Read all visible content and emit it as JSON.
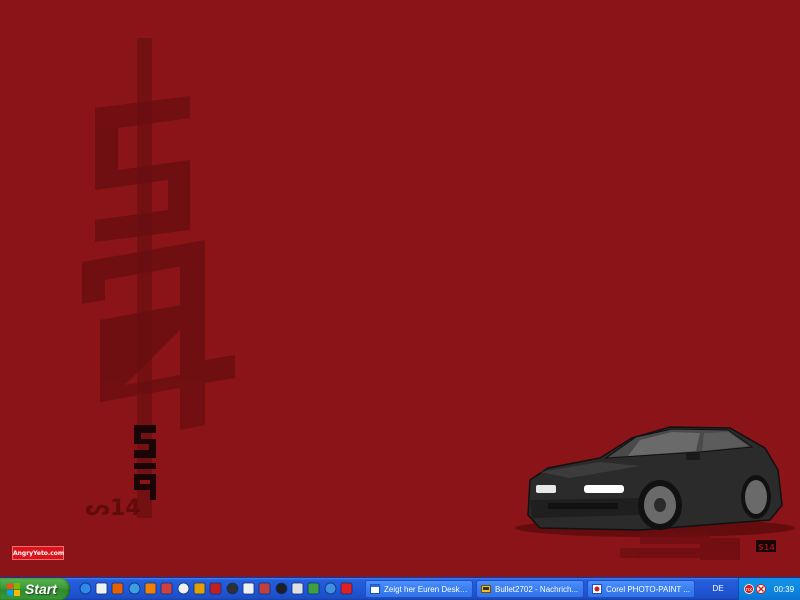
{
  "wallpaper": {
    "background_color": "#8a1417",
    "graphic_text_vertical": "S14",
    "graphic_text_small": "S14",
    "graphic_text_mirror": "S14",
    "site_badge": "AngryYeto.com",
    "corner_tag": "S14",
    "subject": "nissan-silvia-s14-car"
  },
  "taskbar": {
    "start_label": "Start",
    "quick_launch": [
      {
        "name": "internet-explorer-icon",
        "color": "#2e8ae6"
      },
      {
        "name": "notes-icon",
        "color": "#f0f0f0"
      },
      {
        "name": "firefox-icon",
        "color": "#e66000"
      },
      {
        "name": "media-icon",
        "color": "#3aa0e0"
      },
      {
        "name": "vlc-icon",
        "color": "#f08000"
      },
      {
        "name": "photo-icon",
        "color": "#d04040"
      },
      {
        "name": "mail-icon",
        "color": "#f0f0f0"
      },
      {
        "name": "winamp-icon",
        "color": "#e0a000"
      },
      {
        "name": "filezilla-icon",
        "color": "#c02020"
      },
      {
        "name": "terminal-icon",
        "color": "#303030"
      },
      {
        "name": "skull-icon",
        "color": "#f0f0f0"
      },
      {
        "name": "calculator-icon",
        "color": "#c04040"
      },
      {
        "name": "steam-icon",
        "color": "#202020"
      },
      {
        "name": "settings-icon",
        "color": "#e0e0e0"
      },
      {
        "name": "globe-icon",
        "color": "#40a040"
      },
      {
        "name": "refresh-icon",
        "color": "#4090e0"
      },
      {
        "name": "opera-icon",
        "color": "#e02020"
      }
    ],
    "tasks": [
      {
        "label": "Zeigt her Euren Deskt...",
        "icon": "browser-window-icon"
      },
      {
        "label": "Bullet2702 - Nachrich...",
        "icon": "messenger-icon"
      },
      {
        "label": "Corel PHOTO-PAINT ...",
        "icon": "corel-icon"
      }
    ],
    "language": "DE",
    "tray_icons": [
      "network-icon",
      "antivirus-icon"
    ],
    "clock": "00:39"
  }
}
